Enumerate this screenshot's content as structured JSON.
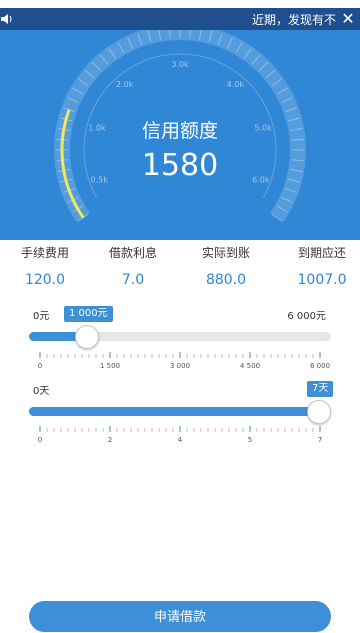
{
  "notice": {
    "text": "近期，发现有不",
    "speaker_icon": "speaker-icon",
    "close_icon": "close-icon"
  },
  "gauge": {
    "title": "信用额度",
    "amount": "1580",
    "scale_labels": [
      "0.5k",
      "1.0k",
      "2.0k",
      "3.0k",
      "4.0k",
      "5.0k",
      "6.0k"
    ],
    "accent_color": "#f2e85a"
  },
  "stats": [
    {
      "label": "手续费用",
      "value": "120.0"
    },
    {
      "label": "借款利息",
      "value": "7.0"
    },
    {
      "label": "实际到账",
      "value": "880.0"
    },
    {
      "label": "到期应还",
      "value": "1007.0"
    }
  ],
  "amount_slider": {
    "min_label": "0元",
    "max_label": "6 000元",
    "current_label": "1 000元",
    "fraction": 0.1667,
    "ticks": [
      "0",
      "1 500",
      "3 000",
      "4 500",
      "6 000"
    ]
  },
  "days_slider": {
    "min_label": "0天",
    "current_label": "7天",
    "fraction": 1.0,
    "ticks": [
      "0",
      "2",
      "4",
      "5",
      "7"
    ]
  },
  "apply_button": {
    "label": "申请借款"
  },
  "colors": {
    "primary": "#2f87d5",
    "button": "#3d8fd8",
    "notice_bar": "#1f4f8e"
  }
}
